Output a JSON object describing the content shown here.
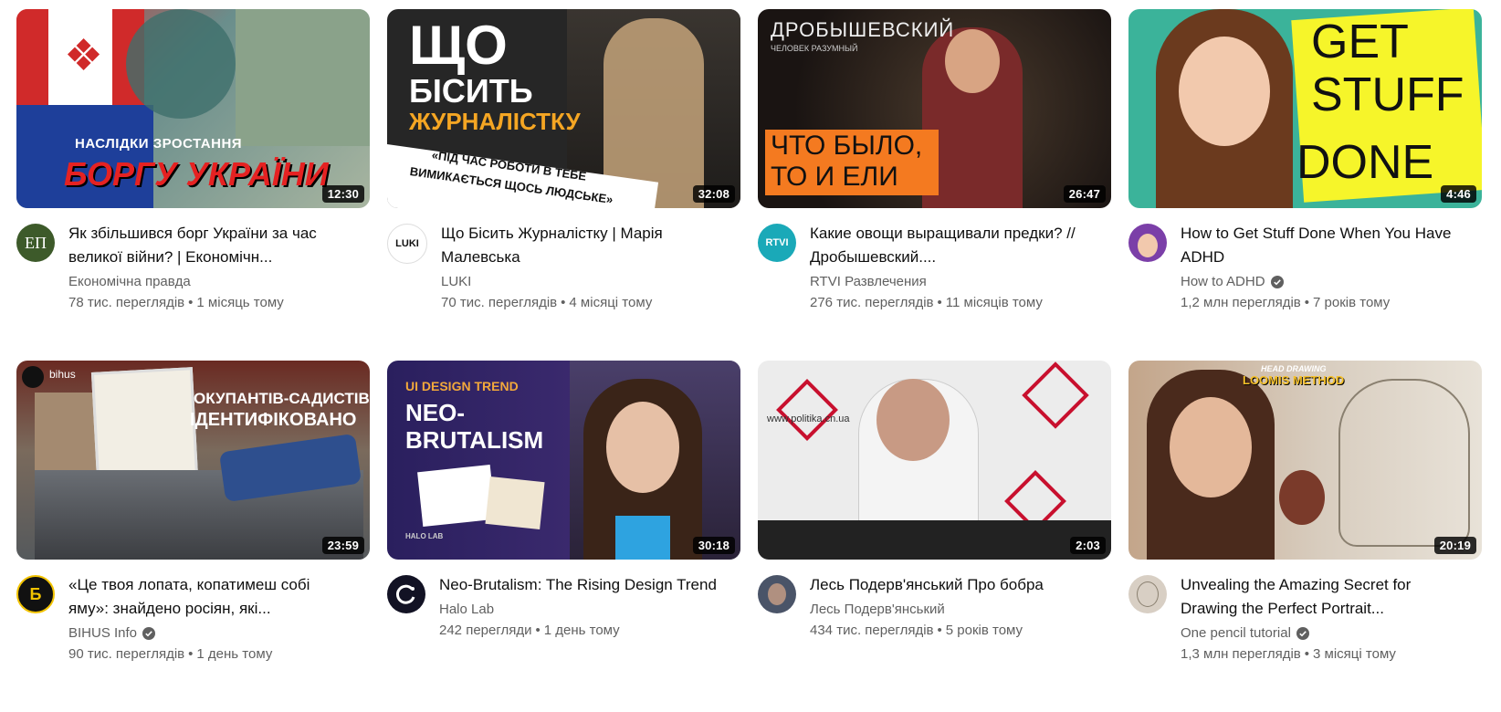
{
  "videos": [
    {
      "title": "Як збільшився борг України за час великої війни? | Економічн...",
      "channel": "Економічна правда",
      "views": "78 тис. переглядів",
      "age": "1 місяць тому",
      "duration": "12:30",
      "verified": false,
      "avatar_text": "ЕП",
      "thumb_text": [
        "НАСЛІДКИ ЗРОСТАННЯ",
        "БОРГУ УКРАЇНИ"
      ],
      "colors": {
        "avatar_bg": "#3d5a2a",
        "thumb_bg": "#5a7b7a"
      }
    },
    {
      "title": "Що Бісить Журналістку | Марія Малевська",
      "channel": "LUKI",
      "views": "70 тис. переглядів",
      "age": "4 місяці тому",
      "duration": "32:08",
      "verified": false,
      "avatar_text": "LUKI",
      "thumb_text": [
        "ЩО",
        "БІСИТЬ",
        "ЖУРНАЛІСТКУ",
        "«ПІД ЧАС РОБОТИ В ТЕБЕ",
        "ВИМИКАЄТЬСЯ ЩОСЬ ЛЮДСЬКЕ»"
      ],
      "colors": {
        "avatar_bg": "#ffffff",
        "thumb_bg": "#2a2a2a",
        "accent": "#f5a623"
      }
    },
    {
      "title": "Какие овощи выращивали предки? // Дробышевский....",
      "channel": "RTVI Развлечения",
      "views": "276 тис. переглядів",
      "age": "11 місяців тому",
      "duration": "26:47",
      "verified": false,
      "avatar_text": "RTVI",
      "thumb_text": [
        "ДРОБЫШЕВСКИЙ",
        "ЧЕЛОВЕК РАЗУМНЫЙ",
        "ЧТО БЫЛО,",
        "ТО И ЕЛИ"
      ],
      "colors": {
        "avatar_bg": "#1aa9b8",
        "thumb_bg": "#1e1a18",
        "accent": "#f47a20"
      }
    },
    {
      "title": "How to Get Stuff Done When You Have ADHD",
      "channel": "How to ADHD",
      "views": "1,2 млн переглядів",
      "age": "7 років тому",
      "duration": "4:46",
      "verified": true,
      "avatar_text": "",
      "thumb_text": [
        "GET",
        "STUFF",
        "DONE"
      ],
      "colors": {
        "avatar_bg": "#7b3fa8",
        "thumb_bg": "#3bb39a",
        "accent": "#f6f52a"
      }
    },
    {
      "title": "«Це твоя лопата, копатимеш собі яму»: знайдено росіян, які...",
      "channel": "BIHUS Info",
      "views": "90 тис. переглядів",
      "age": "1 день тому",
      "duration": "23:59",
      "verified": true,
      "avatar_text": "Б",
      "thumb_text": [
        "bihus",
        "ОКУПАНТІВ-САДИСТІВ",
        "ІДЕНТИФІКОВАНО"
      ],
      "colors": {
        "avatar_bg": "#111111",
        "thumb_bg": "#5a4a3e",
        "accent": "#f2c300"
      }
    },
    {
      "title": "Neo-Brutalism: The Rising Design Trend",
      "channel": "Halo Lab",
      "views": "242 перегляди",
      "age": "1 день тому",
      "duration": "30:18",
      "verified": false,
      "avatar_text": "",
      "thumb_text": [
        "UI DESIGN TREND",
        "NEO-",
        "BRUTALISM",
        "HALO LAB"
      ],
      "colors": {
        "avatar_bg": "#121224",
        "thumb_bg": "#2a1f5e",
        "accent": "#f2a83b"
      }
    },
    {
      "title": "Лесь Подерв'янський Про бобра",
      "channel": "Лесь Подерв'янський",
      "views": "434 тис. переглядів",
      "age": "5 років тому",
      "duration": "2:03",
      "verified": false,
      "avatar_text": "",
      "thumb_text": [
        "www.politika.cn.ua"
      ],
      "colors": {
        "avatar_bg": "#4a5468",
        "thumb_bg": "#eeeeee",
        "accent": "#c8102e"
      }
    },
    {
      "title": "Unvealing the Amazing Secret for Drawing the Perfect Portrait...",
      "channel": "One pencil tutorial",
      "views": "1,3 млн переглядів",
      "age": "3 місяці тому",
      "duration": "20:19",
      "verified": true,
      "avatar_text": "",
      "thumb_text": [
        "HEAD DRAWING",
        "LOOMIS METHOD"
      ],
      "colors": {
        "avatar_bg": "#d8cfc4",
        "thumb_bg": "#c7b9a6",
        "accent": "#f6c12a"
      }
    }
  ]
}
